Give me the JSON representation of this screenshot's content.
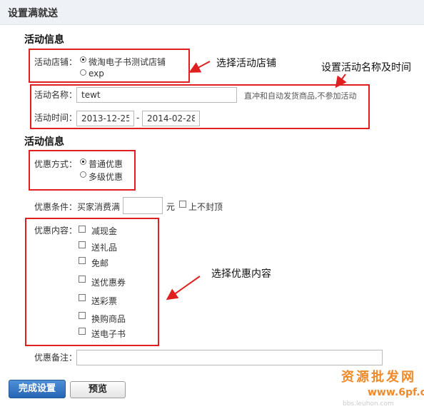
{
  "page": {
    "title": "设置满就送"
  },
  "sections": {
    "activity_info": "活动信息",
    "activity_info_2": "活动信息"
  },
  "store": {
    "label": "活动店铺：",
    "options": [
      "微淘电子书测试店铺",
      "exp"
    ],
    "selected": "微淘电子书测试店铺"
  },
  "activity_name": {
    "label": "活动名称：",
    "value": "tewt",
    "hint": "直冲和自动发货商品,不参加活动"
  },
  "activity_time": {
    "label": "活动时间：",
    "start": "2013-12-25",
    "separator": "-",
    "end": "2014-02-28"
  },
  "discount_method": {
    "label": "优惠方式：",
    "options": [
      "普通优惠",
      "多级优惠"
    ],
    "selected": "普通优惠"
  },
  "discount_condition": {
    "label": "优惠条件：",
    "prefix": "买家消费满",
    "value": "",
    "unit": "元",
    "checkbox_label": "上不封顶"
  },
  "discount_content": {
    "label": "优惠内容：",
    "items": [
      "减现金",
      "送礼品",
      "免邮",
      "送优惠券",
      "送彩票",
      "换购商品",
      "送电子书"
    ]
  },
  "discount_note": {
    "label": "优惠备注：",
    "value": ""
  },
  "buttons": {
    "finish": "完成设置",
    "preview": "预览"
  },
  "annotations": {
    "store": "选择活动店铺",
    "name_time": "设置活动名称及时间",
    "content": "选择优惠内容"
  },
  "watermark": {
    "line1": "资源批发网",
    "line2": "www.6pf.cn",
    "line3": "bbs.leuhon.com"
  },
  "colors": {
    "annotation_box": "#e02020",
    "primary_button": "#2a6bbf",
    "header_bg": "#eef2f6",
    "watermark": "#ef8a2a"
  }
}
